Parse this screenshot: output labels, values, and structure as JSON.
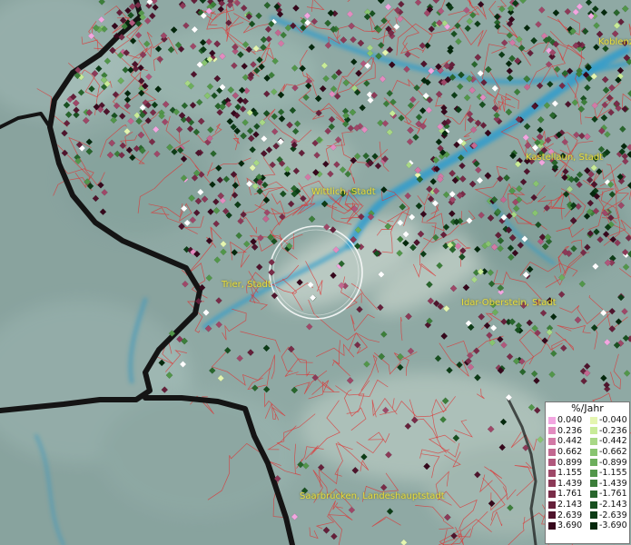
{
  "cities": [
    {
      "name": "Koblenz",
      "id": "koblenz"
    },
    {
      "name": "Kastellaun, Stadt",
      "id": "kastellaun"
    },
    {
      "name": "Wittlich, Stadt",
      "id": "wittlich"
    },
    {
      "name": "Trier, Stadt",
      "id": "trier"
    },
    {
      "name": "Idar-Oberstein, Stadt",
      "id": "idar-oberstein"
    },
    {
      "name": "Saarbrücken, Landeshauptstadt",
      "id": "saarbruecken"
    }
  ],
  "legend": {
    "title": "%/Jahr",
    "positive": [
      {
        "label": "0.040",
        "color": "#f2a6e0"
      },
      {
        "label": "0.236",
        "color": "#e28cc0"
      },
      {
        "label": "0.442",
        "color": "#d27aa6"
      },
      {
        "label": "0.662",
        "color": "#c26890"
      },
      {
        "label": "0.899",
        "color": "#b0587c"
      },
      {
        "label": "1.155",
        "color": "#9e4868"
      },
      {
        "label": "1.439",
        "color": "#8c3a58"
      },
      {
        "label": "1.761",
        "color": "#782c48"
      },
      {
        "label": "2.143",
        "color": "#64203a"
      },
      {
        "label": "2.639",
        "color": "#4e142c"
      },
      {
        "label": "3.690",
        "color": "#36081c"
      }
    ],
    "negative": [
      {
        "label": "-0.040",
        "color": "#e4f5b0"
      },
      {
        "label": "-0.236",
        "color": "#c8eb98"
      },
      {
        "label": "-0.442",
        "color": "#a8d886"
      },
      {
        "label": "-0.662",
        "color": "#88c470"
      },
      {
        "label": "-0.899",
        "color": "#6cae5c"
      },
      {
        "label": "-1.155",
        "color": "#52964a"
      },
      {
        "label": "-1.439",
        "color": "#3c7e3a"
      },
      {
        "label": "-1.761",
        "color": "#28662c"
      },
      {
        "label": "-2.143",
        "color": "#185020"
      },
      {
        "label": "-2.639",
        "color": "#0c3c16"
      },
      {
        "label": "-3.690",
        "color": "#04280c"
      }
    ]
  },
  "colors": {
    "border": "#141414",
    "admin_lines": "#e03030",
    "river": "#2e9ccc",
    "terrain": "#8fa9a4",
    "city_label": "#e8dd3c",
    "zero_point": "#ffffff"
  }
}
